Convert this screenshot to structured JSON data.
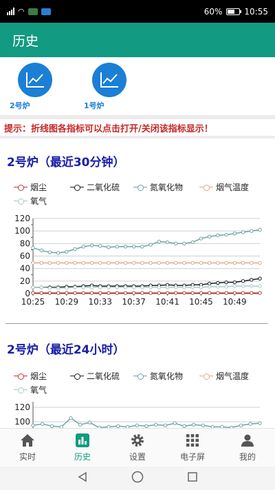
{
  "status_bar": {
    "battery_percent": "60%",
    "time": "10:55"
  },
  "header": {
    "title": "历史"
  },
  "furnaces": [
    {
      "label": "2号炉",
      "icon": "line-chart-icon"
    },
    {
      "label": "1号炉",
      "icon": "line-chart-icon"
    }
  ],
  "hint": {
    "text": "提示：折线图各指标可以点击打开/关闭该指标显示！"
  },
  "legend_labels": [
    "烟尘",
    "二氧化硫",
    "氮氧化物",
    "烟气温度",
    "氧气"
  ],
  "legend_colors": [
    "#b83a3a",
    "#1c1c1c",
    "#6fa3a3",
    "#e0a88a",
    "#a9c8c8"
  ],
  "chart_data": [
    {
      "type": "line",
      "title": "2号炉（最近30分钟）",
      "x": [
        "10:25",
        "10:26",
        "10:27",
        "10:28",
        "10:29",
        "10:30",
        "10:31",
        "10:32",
        "10:33",
        "10:34",
        "10:35",
        "10:36",
        "10:37",
        "10:38",
        "10:39",
        "10:40",
        "10:41",
        "10:42",
        "10:43",
        "10:44",
        "10:45",
        "10:46",
        "10:47",
        "10:48",
        "10:49",
        "10:50",
        "10:51",
        "10:52"
      ],
      "x_tick_labels": [
        "10:25",
        "10:29",
        "10:33",
        "10:37",
        "10:41",
        "10:45",
        "10:49"
      ],
      "y_ticks": [
        "0",
        "10",
        "20",
        "30",
        "40",
        "50",
        "60",
        "70",
        "80",
        "90",
        "100",
        "110",
        "120"
      ],
      "ylim": [
        0,
        120
      ],
      "grid": true,
      "series": [
        {
          "name": "烟尘",
          "color": "#b83a3a",
          "values": [
            1,
            1,
            1,
            1,
            1,
            1,
            1,
            1,
            1,
            1,
            1,
            1,
            1,
            1,
            1,
            1,
            1,
            1,
            1,
            1,
            1,
            1,
            1,
            1,
            1,
            1,
            1,
            1
          ]
        },
        {
          "name": "二氧化硫",
          "color": "#1c1c1c",
          "values": [
            10,
            10,
            10,
            10,
            11,
            11,
            12,
            13,
            12,
            12,
            12,
            12,
            12,
            12,
            13,
            13,
            14,
            13,
            13,
            14,
            14,
            16,
            17,
            18,
            18,
            20,
            22,
            24
          ]
        },
        {
          "name": "氮氧化物",
          "color": "#6fa3a3",
          "values": [
            73,
            69,
            66,
            65,
            67,
            71,
            75,
            77,
            76,
            74,
            75,
            75,
            75,
            75,
            78,
            83,
            82,
            80,
            80,
            82,
            88,
            91,
            93,
            94,
            96,
            98,
            100,
            102
          ]
        },
        {
          "name": "烟气温度",
          "color": "#e0a88a",
          "values": [
            49,
            49,
            49,
            49,
            49,
            49,
            49,
            49,
            49,
            49,
            49,
            49,
            49,
            49,
            49,
            49,
            49,
            49,
            49,
            49,
            49,
            49,
            49,
            49,
            49,
            49,
            49,
            49
          ]
        },
        {
          "name": "氧气",
          "color": "#a9c8c8",
          "values": [
            10,
            10,
            9,
            9,
            9,
            10,
            10,
            10,
            10,
            10,
            10,
            10,
            10,
            10,
            10,
            10,
            10,
            10,
            10,
            10,
            10,
            11,
            11,
            11,
            12,
            12,
            12,
            12
          ]
        }
      ]
    },
    {
      "type": "line",
      "title": "2号炉（最近24小时）",
      "y_ticks": [
        "100",
        "120"
      ],
      "ylim": [
        0,
        120
      ],
      "grid": true,
      "series": [
        {
          "name": "烟尘",
          "color": "#b83a3a",
          "values": []
        },
        {
          "name": "二氧化硫",
          "color": "#1c1c1c",
          "values": []
        },
        {
          "name": "氮氧化物",
          "color": "#6fa3a3",
          "values": [
            95,
            97,
            94,
            93,
            105,
            96,
            99,
            92,
            93,
            94,
            93,
            95,
            94,
            96,
            95,
            98,
            94,
            96,
            95,
            93,
            93,
            92,
            95,
            97,
            98
          ]
        },
        {
          "name": "烟气温度",
          "color": "#e0a88a",
          "values": []
        },
        {
          "name": "氧气",
          "color": "#a9c8c8",
          "values": []
        }
      ]
    }
  ],
  "bottom_nav": [
    {
      "label": "实时",
      "icon": "home-icon",
      "active": false
    },
    {
      "label": "历史",
      "icon": "bar-chart-icon",
      "active": true
    },
    {
      "label": "设置",
      "icon": "gear-icon",
      "active": false
    },
    {
      "label": "电子屏",
      "icon": "grid-icon",
      "active": false
    },
    {
      "label": "我的",
      "icon": "person-icon",
      "active": false
    }
  ]
}
